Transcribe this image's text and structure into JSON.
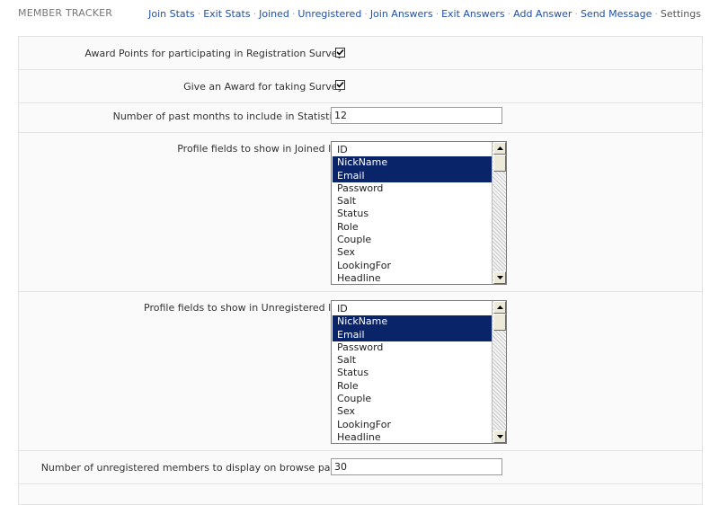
{
  "header": {
    "title": "MEMBER TRACKER",
    "nav": [
      {
        "label": "Join Stats"
      },
      {
        "label": "Exit Stats"
      },
      {
        "label": "Joined"
      },
      {
        "label": "Unregistered"
      },
      {
        "label": "Join Answers"
      },
      {
        "label": "Exit Answers"
      },
      {
        "label": "Add Answer"
      },
      {
        "label": "Send Message"
      },
      {
        "label": "Settings"
      }
    ]
  },
  "settings": {
    "award_points": {
      "label": "Award Points for participating in Registration Survey:",
      "checked": true
    },
    "award_survey": {
      "label": "Give an Award for taking Survey:",
      "checked": true
    },
    "past_months": {
      "label": "Number of past months to include in Statistics:",
      "value": "12"
    },
    "joined_fields": {
      "label": "Profile fields to show in Joined list:",
      "options": [
        {
          "text": "ID",
          "selected": false
        },
        {
          "text": "NickName",
          "selected": true
        },
        {
          "text": "Email",
          "selected": true
        },
        {
          "text": "Password",
          "selected": false
        },
        {
          "text": "Salt",
          "selected": false
        },
        {
          "text": "Status",
          "selected": false
        },
        {
          "text": "Role",
          "selected": false
        },
        {
          "text": "Couple",
          "selected": false
        },
        {
          "text": "Sex",
          "selected": false
        },
        {
          "text": "LookingFor",
          "selected": false
        },
        {
          "text": "Headline",
          "selected": false
        }
      ]
    },
    "unregistered_fields": {
      "label": "Profile fields to show in Unregistered list:",
      "options": [
        {
          "text": "ID",
          "selected": false
        },
        {
          "text": "NickName",
          "selected": true
        },
        {
          "text": "Email",
          "selected": true
        },
        {
          "text": "Password",
          "selected": false
        },
        {
          "text": "Salt",
          "selected": false
        },
        {
          "text": "Status",
          "selected": false
        },
        {
          "text": "Role",
          "selected": false
        },
        {
          "text": "Couple",
          "selected": false
        },
        {
          "text": "Sex",
          "selected": false
        },
        {
          "text": "LookingFor",
          "selected": false
        },
        {
          "text": "Headline",
          "selected": false
        }
      ]
    },
    "unregistered_per_page": {
      "label": "Number of unregistered members to display on browse page:",
      "value": "30"
    }
  },
  "icons": {
    "checkmark": "checkmark-icon",
    "scroll_up": "arrow-up-icon",
    "scroll_down": "arrow-down-icon"
  },
  "colors": {
    "link": "#2050a8",
    "selection": "#0a246a",
    "panel_bg": "#fafafa",
    "border": "#e2e2e2"
  }
}
